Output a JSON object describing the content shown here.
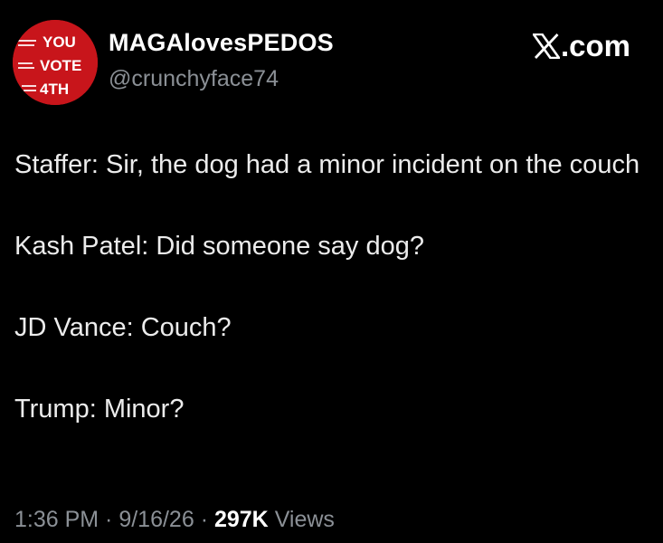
{
  "user": {
    "display_name": "MAGAlovesPEDOS",
    "handle": "@crunchyface74",
    "avatar_text": [
      "YOU",
      "VOTE",
      "4TH"
    ]
  },
  "site": {
    "label": ".com",
    "logo_icon": "x-logo-icon"
  },
  "tweet": {
    "lines": [
      "Staffer: Sir, the dog had a minor incident on the couch",
      "Kash Patel: Did someone say dog?",
      "JD Vance: Couch?",
      "Trump: Minor?"
    ]
  },
  "meta": {
    "time": "1:36 PM",
    "date": "9/16/26",
    "separator": " · ",
    "views_count": "297K",
    "views_label": "Views"
  },
  "colors": {
    "background": "#000000",
    "text": "#e7e9ea",
    "muted": "#8b9096",
    "avatar_red": "#c8151b"
  }
}
